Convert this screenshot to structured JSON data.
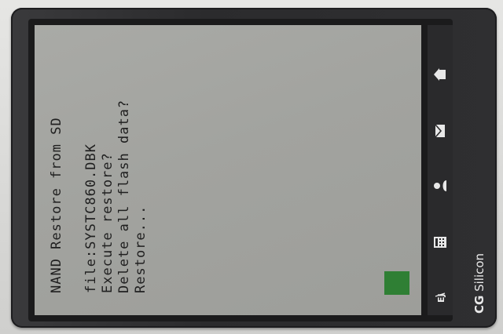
{
  "screen": {
    "lines": [
      "NAND Restore from SD",
      "file:SYSTC860.DBK",
      "Execute restore?",
      "Delete all flash data?",
      "Restore..."
    ]
  },
  "brand": {
    "mark": "CG",
    "name": "Silicon"
  },
  "icons": [
    "home-icon",
    "mail-icon",
    "contacts-icon",
    "calculator-icon",
    "dictionary-icon"
  ],
  "colors": {
    "lcd": "#a5a6a2",
    "cursor": "#2f7f34",
    "bezel": "#2f2f31"
  }
}
